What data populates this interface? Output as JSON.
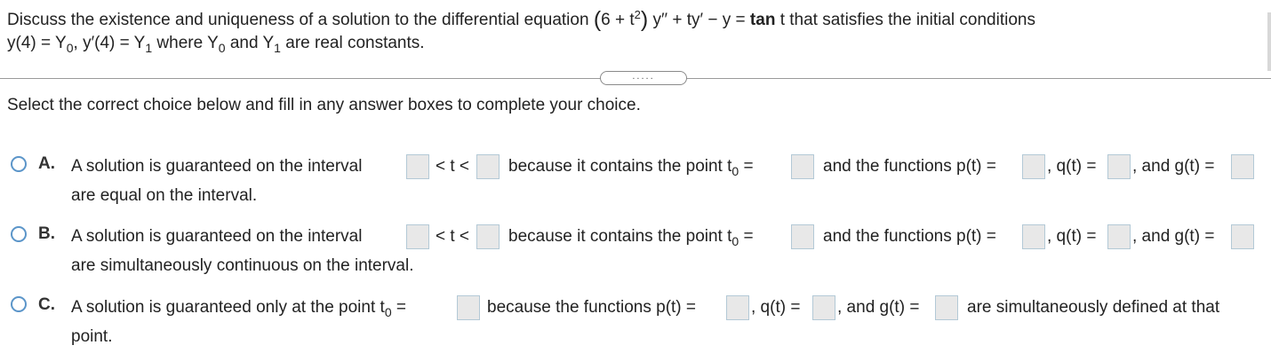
{
  "problem": {
    "line1_a": "Discuss the existence and uniqueness of a solution to the differential equation",
    "eq_open": "(",
    "eq_six": "6 + t",
    "eq_sq": "2",
    "eq_close": ")",
    "eq_rest": "y′′ + ty′ − y =",
    "eq_tan": "tan",
    "eq_t": "t that satisfies the initial conditions",
    "line2_a": "y(4) = Y",
    "sub0": "0",
    "line2_b": ", y′(4) = Y",
    "sub1": "1",
    "line2_c": "where Y",
    "sub0b": "0",
    "line2_d": "and Y",
    "sub1b": "1",
    "line2_e": "are real constants."
  },
  "expand_button": {
    "label": "....."
  },
  "instruction": "Select the correct choice below and fill in any answer boxes to complete your choice.",
  "choices": {
    "a": {
      "letter": "A.",
      "text1": "A solution is guaranteed on the interval",
      "lt": "< t <",
      "because": "because it contains the point t",
      "sub": "0",
      "eq": "=",
      "fn": "and the functions p(t) =",
      "q": ", q(t) =",
      "g": ", and g(t) =",
      "line2": "are equal on the interval."
    },
    "b": {
      "letter": "B.",
      "text1": "A solution is guaranteed on the interval",
      "lt": "< t <",
      "because": "because it contains the point t",
      "sub": "0",
      "eq": "=",
      "fn": "and the functions p(t) =",
      "q": ", q(t) =",
      "g": ", and g(t) =",
      "line2": "are simultaneously continuous on the interval."
    },
    "c": {
      "letter": "C.",
      "text1": "A solution is guaranteed only at the point t",
      "sub": "0",
      "eq": "=",
      "because": "because the functions p(t) =",
      "q": ", q(t) =",
      "g": ", and g(t) =",
      "rest": "are simultaneously defined at that",
      "line2": "point."
    }
  }
}
